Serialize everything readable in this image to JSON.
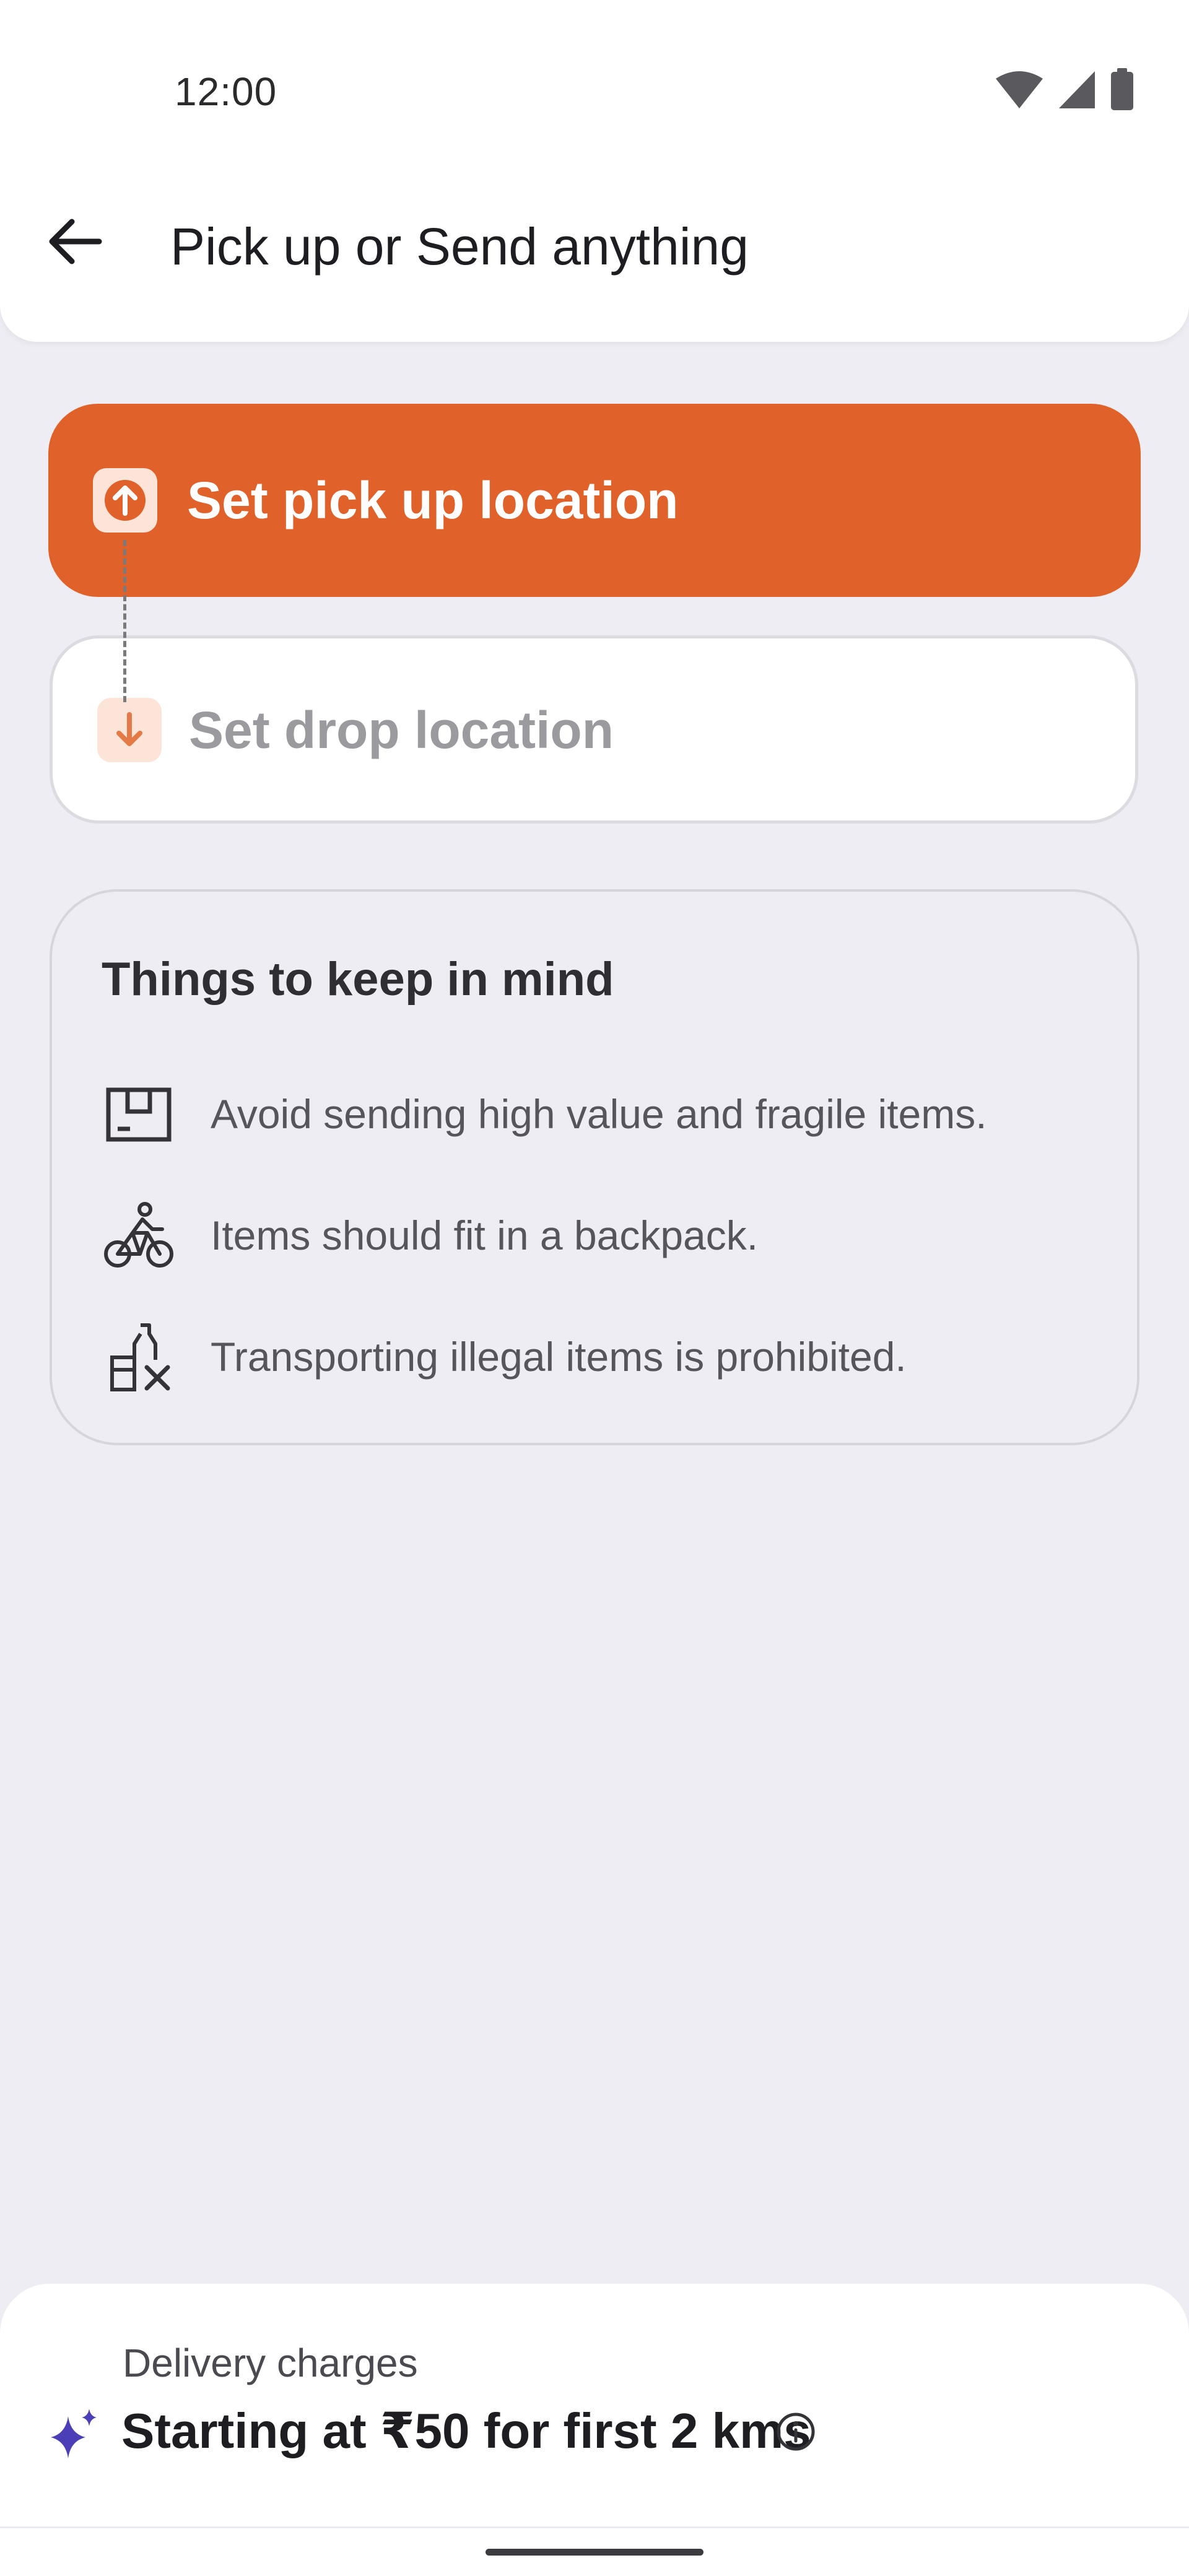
{
  "status_bar": {
    "time": "12:00",
    "icons": [
      "wifi-icon",
      "cellular-signal-icon",
      "battery-icon"
    ]
  },
  "header": {
    "back_icon": "arrow-left-icon",
    "title": "Pick up or Send anything"
  },
  "locations": {
    "pickup": {
      "label": "Set pick up location",
      "icon": "arrow-up-icon"
    },
    "drop": {
      "label": "Set drop location",
      "icon": "arrow-down-icon"
    }
  },
  "guidelines": {
    "title": "Things to keep in mind",
    "items": [
      {
        "icon": "package-box-icon",
        "text": "Avoid sending high value and fragile items."
      },
      {
        "icon": "bicycle-rider-icon",
        "text": "Items should fit in a backpack."
      },
      {
        "icon": "prohibited-items-icon",
        "text": "Transporting illegal items is prohibited."
      }
    ]
  },
  "delivery": {
    "label": "Delivery charges",
    "price_text": "Starting at ₹50 for first 2 kms",
    "icon": "sparkle-icon",
    "info_icon": "info-icon"
  },
  "colors": {
    "accent": "#E0622A",
    "accent_light": "#FCE5D8",
    "background": "#EEEDF3",
    "sparkle": "#4B3FB8"
  }
}
